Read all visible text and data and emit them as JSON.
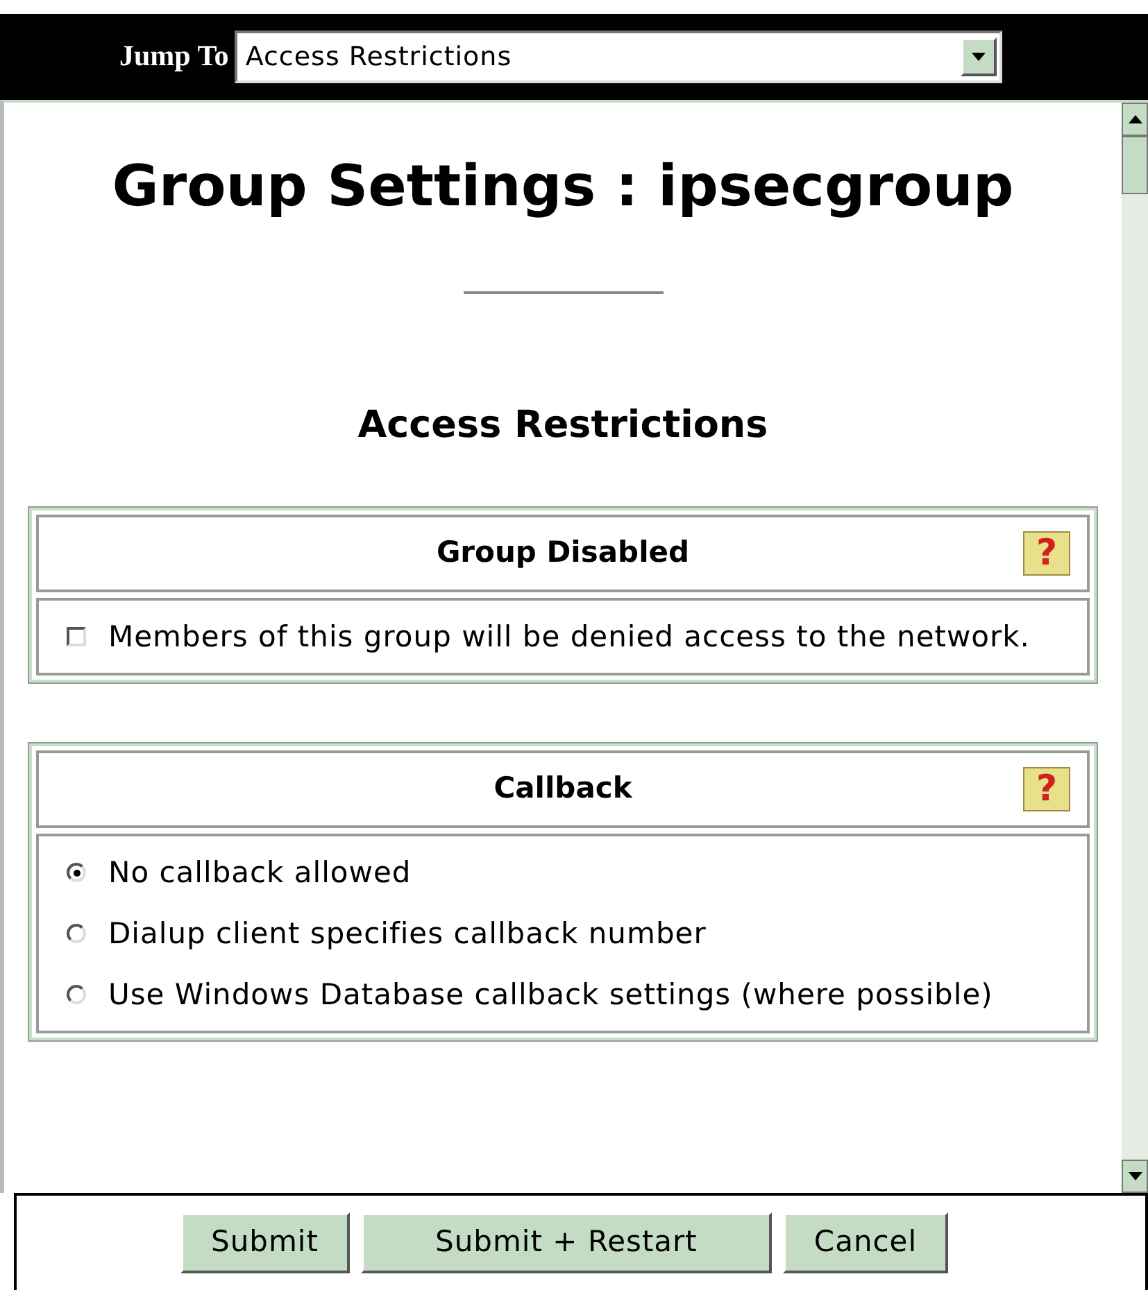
{
  "jump_to": {
    "label": "Jump To",
    "value": "Access Restrictions"
  },
  "title": "Group Settings : ipsecgroup",
  "section_title": "Access Restrictions",
  "panels": [
    {
      "kind": "checkbox",
      "title": "Group Disabled",
      "help": "?",
      "options": [
        {
          "label": "Members of this group will be denied access to the network.",
          "checked": false
        }
      ]
    },
    {
      "kind": "radio",
      "title": "Callback",
      "help": "?",
      "options": [
        {
          "label": "No callback allowed",
          "selected": true
        },
        {
          "label": "Dialup client specifies callback number",
          "selected": false
        },
        {
          "label": "Use Windows Database callback settings (where possible)",
          "selected": false
        }
      ]
    }
  ],
  "buttons": [
    "Submit",
    "Submit + Restart",
    "Cancel"
  ]
}
